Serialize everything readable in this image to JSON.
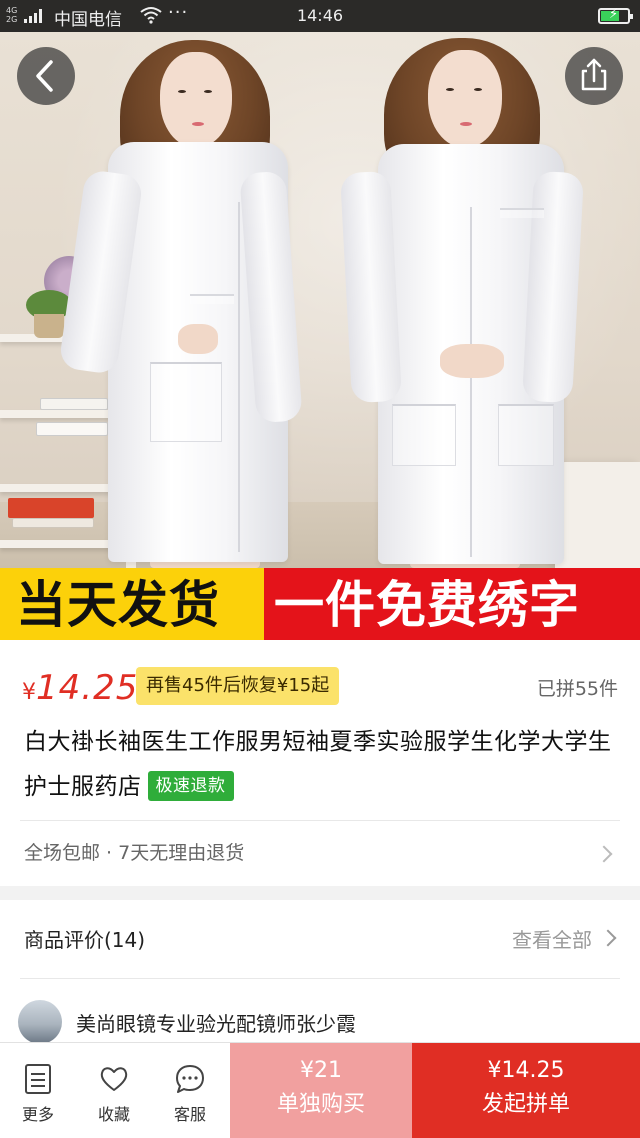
{
  "status_bar": {
    "network": "4G\n2G",
    "carrier": "中国电信",
    "more": "···",
    "time": "14:46",
    "battery_level": 0.7,
    "battery_color": "#3ad15a"
  },
  "hero": {
    "back_icon": "chevron-left-icon",
    "share_icon": "share-icon"
  },
  "banner": {
    "left_text": "当天发货",
    "right_text": "一件免费绣字",
    "left_color": "#fcd10a",
    "right_color": "#e4131a"
  },
  "product": {
    "currency": "¥",
    "price": "14.25",
    "restock_note": "再售45件后恢复¥15起",
    "sold_count": "已拼55件",
    "title": "白大褂长袖医生工作服男短袖夏季实验服学生化学大学生护士服药店",
    "refund_tag": "极速退款",
    "service_text": "全场包邮 · 7天无理由退货",
    "price_color": "#e02e24"
  },
  "reviews": {
    "title": "商品评价(14)",
    "view_all": "查看全部",
    "first_reviewer": "美尚眼镜专业验光配镜师张少霞"
  },
  "bottom_bar": {
    "more_label": "更多",
    "favorite_label": "收藏",
    "service_label": "客服",
    "single_price": "¥21",
    "single_label": "单独购买",
    "group_price": "¥14.25",
    "group_label": "发起拼单",
    "single_color": "#f1a09f",
    "group_color": "#e02e24"
  }
}
